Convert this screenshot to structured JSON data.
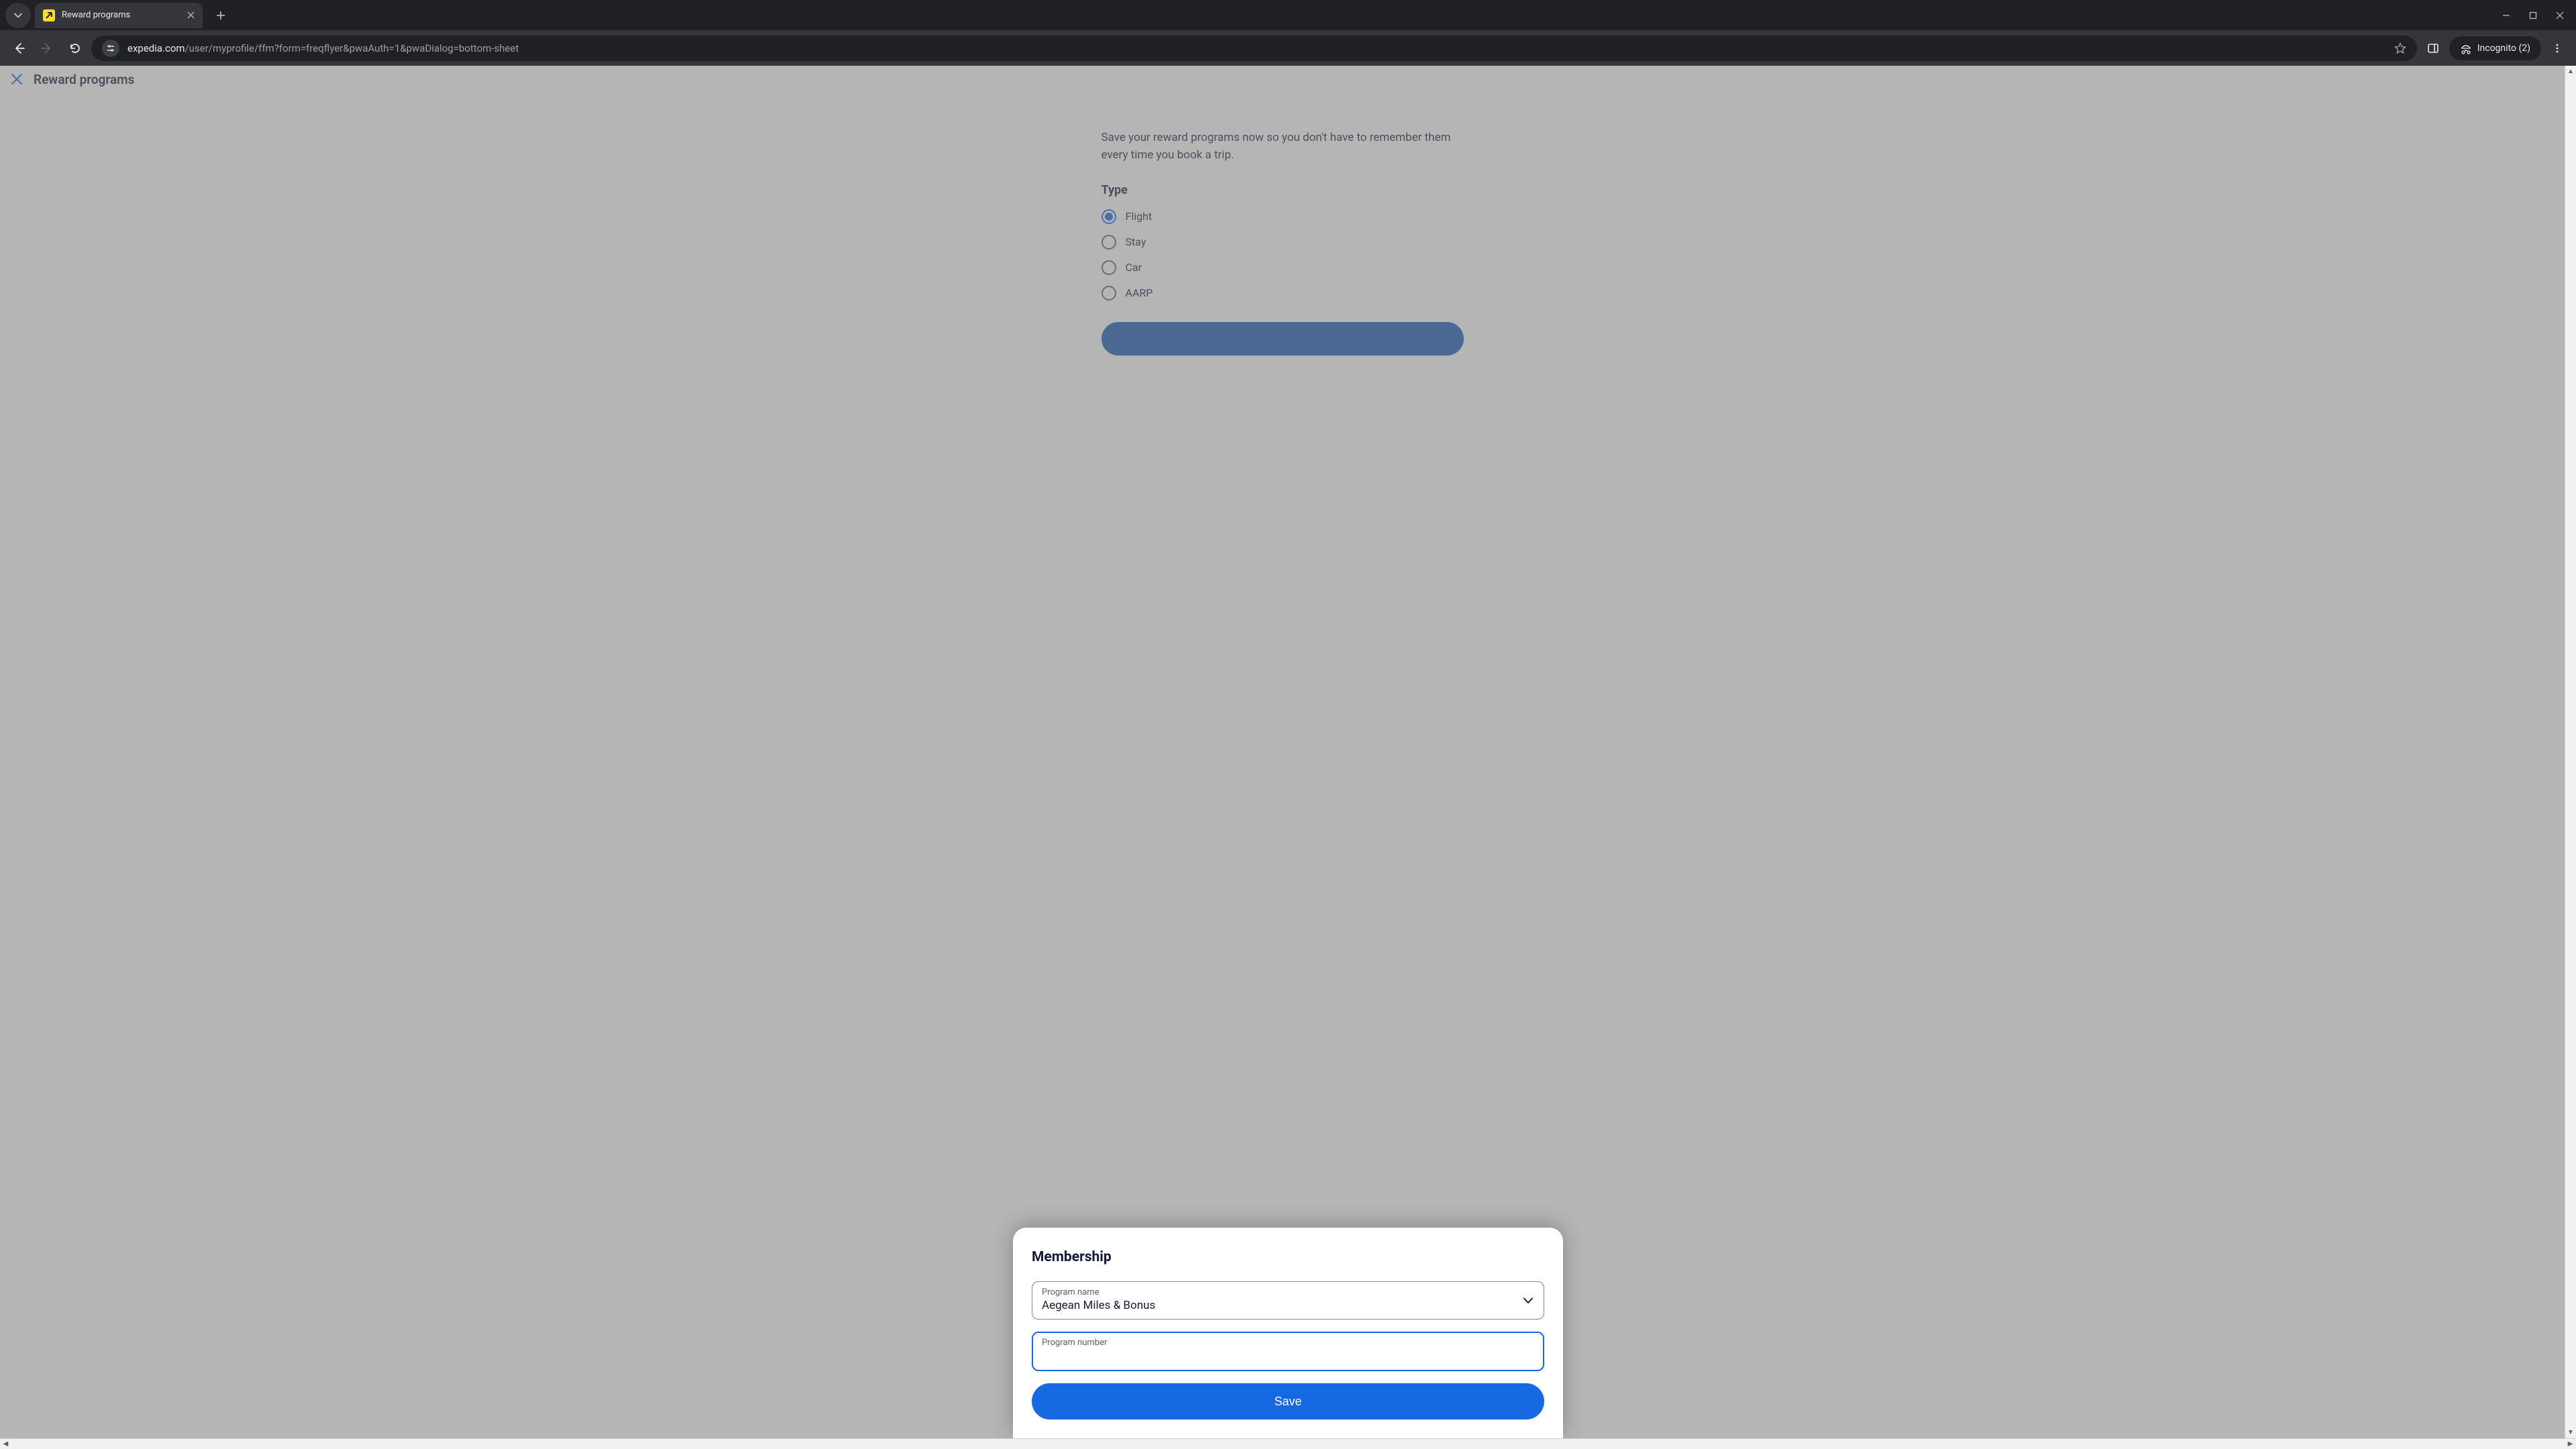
{
  "browser": {
    "tab_title": "Reward programs",
    "incognito_label": "Incognito (2)",
    "url_domain": "expedia.com",
    "url_path": "/user/myprofile/ffm?form=freqflyer&pwaAuth=1&pwaDialog=bottom-sheet"
  },
  "page": {
    "title": "Reward programs",
    "intro": "Save your reward programs now so you don't have to remember them every time you book a trip.",
    "type_label": "Type",
    "radios": [
      {
        "label": "Flight",
        "selected": true
      },
      {
        "label": "Stay",
        "selected": false
      },
      {
        "label": "Car",
        "selected": false
      },
      {
        "label": "AARP",
        "selected": false
      }
    ]
  },
  "modal": {
    "title": "Membership",
    "program_name_label": "Program name",
    "program_name_value": "Aegean Miles & Bonus",
    "program_number_label": "Program number",
    "program_number_value": "",
    "save_label": "Save"
  }
}
